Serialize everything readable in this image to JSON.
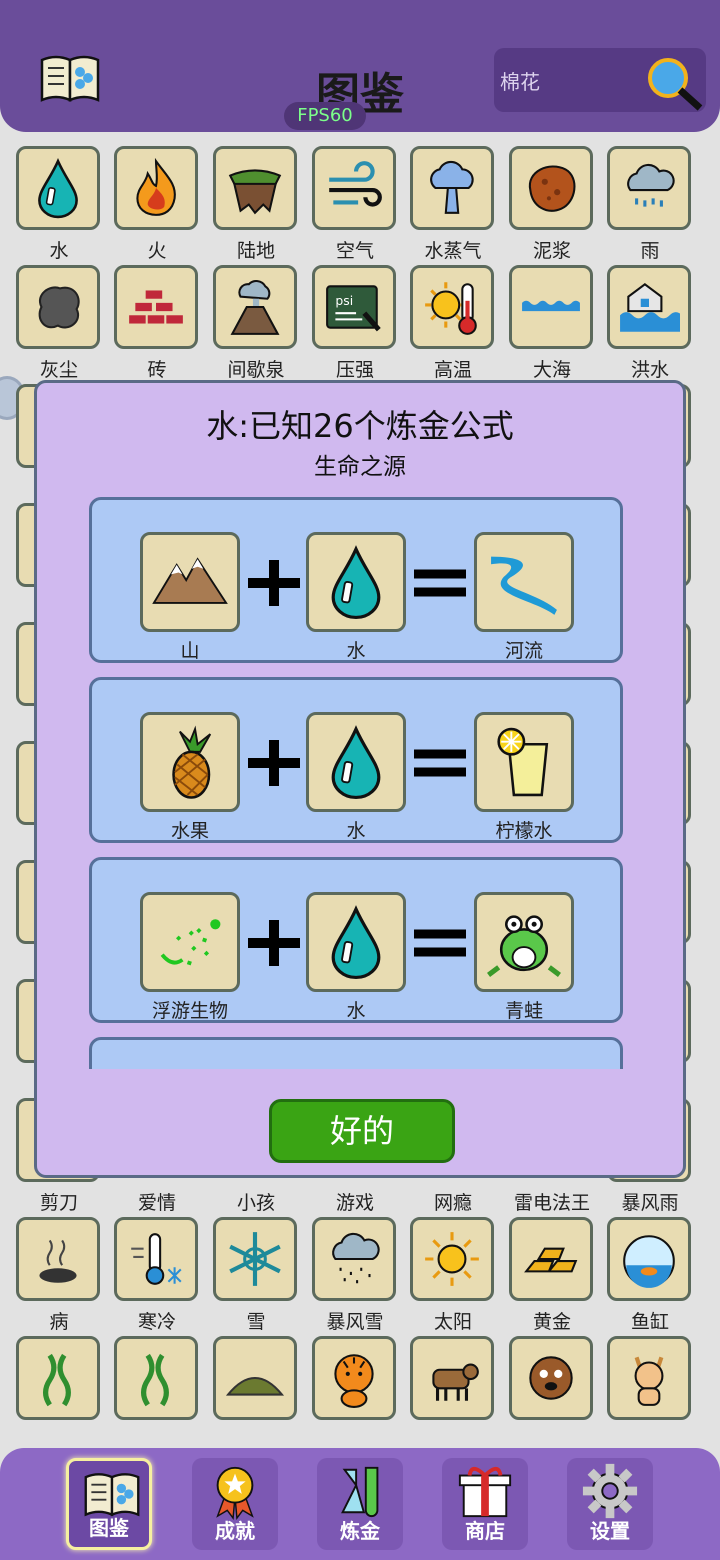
{
  "header": {
    "title": "图鉴",
    "fps": "FPS60",
    "search_value": "棉花"
  },
  "grid": {
    "row1": [
      "水",
      "火",
      "陆地",
      "空气",
      "水蒸气",
      "泥浆",
      "雨"
    ],
    "row2": [
      "灰尘",
      "砖",
      "间歇泉",
      "压强",
      "高温",
      "大海",
      "洪水"
    ],
    "row9": [
      "剪刀",
      "爱情",
      "小孩",
      "游戏",
      "网瘾",
      "雷电法王",
      "暴风雨"
    ],
    "row10": [
      "病",
      "寒冷",
      "雪",
      "暴风雪",
      "太阳",
      "黄金",
      "鱼缸"
    ]
  },
  "dialog": {
    "title": "水:已知26个炼金公式",
    "subtitle": "生命之源",
    "recipes": [
      {
        "a": "山",
        "b": "水",
        "result": "河流"
      },
      {
        "a": "水果",
        "b": "水",
        "result": "柠檬水"
      },
      {
        "a": "浮游生物",
        "b": "水",
        "result": "青蛙"
      }
    ],
    "ok_label": "好的"
  },
  "nav": {
    "items": [
      "图鉴",
      "成就",
      "炼金",
      "商店",
      "设置"
    ],
    "active": "图鉴"
  },
  "colors": {
    "header": "#6a4d9a",
    "dialog": "#d0b9ef",
    "recipe_card": "#adc9f5",
    "tile": "#e8dcb2",
    "ok_button": "#3aa414",
    "nav": "#8d69c5"
  }
}
